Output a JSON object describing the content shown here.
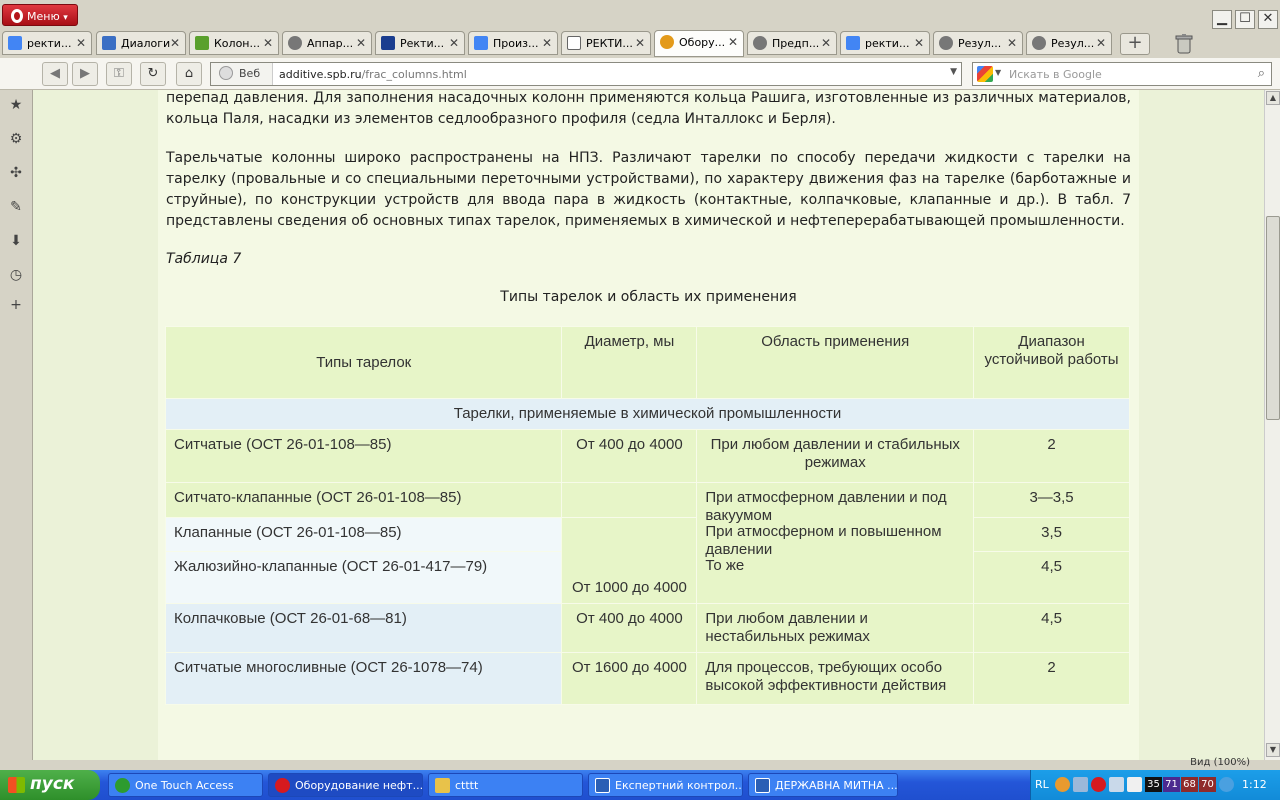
{
  "browser": {
    "menu_label": "Меню",
    "tabs": [
      {
        "label": "ректи...",
        "icon": "google-icon",
        "color": "#4285f4"
      },
      {
        "label": "Диалоги",
        "icon": "speech-bubble-icon",
        "color": "#3b6fc4"
      },
      {
        "label": "Колон...",
        "icon": "spreadsheet-icon",
        "color": "#5aa02c"
      },
      {
        "label": "Аппар...",
        "icon": "globe-icon",
        "color": "#777777"
      },
      {
        "label": "Ректи...",
        "icon": "site-icon",
        "color": "#1a3d8f"
      },
      {
        "label": "Произ...",
        "icon": "google-icon",
        "color": "#4285f4"
      },
      {
        "label": "РЕКТИ...",
        "icon": "document-icon",
        "color": "#666666"
      },
      {
        "label": "Обору...",
        "icon": "gear-site-icon",
        "color": "#e39a1a"
      },
      {
        "label": "Предп...",
        "icon": "globe-icon",
        "color": "#777777"
      },
      {
        "label": "ректи...",
        "icon": "google-icon",
        "color": "#4285f4"
      },
      {
        "label": "Резул...",
        "icon": "globe-icon",
        "color": "#777777"
      },
      {
        "label": "Резул...",
        "icon": "globe-icon",
        "color": "#777777"
      }
    ],
    "active_tab": 7,
    "address": {
      "label": "Веб",
      "url_domain": "additive.spb.ru",
      "url_path": "/frac_columns.html"
    },
    "search_placeholder": "Искать в Google",
    "zoom": "Вид (100%)"
  },
  "page": {
    "para1": "перепад давления. Для заполнения насадочных колонн применяются кольца Рашига, изготовленные из различных материалов, кольца Паля, насадки из элементов седлообразного профиля (седла Инталлокс и Берля).",
    "para2": "Тарельчатые колонны широко распространены на НПЗ. Различают тарелки по способу передачи жидкости с тарелки на тарелку (провальные и со специальными переточными устройствами), по характеру движения фаз на тарелке (барботажные и струйные), по конструкции устройств для ввода пара в жидкость (контактные, колпачковые, клапанные и др.). В табл. 7 представлены сведения об основных типах тарелок, применяемых в химической и нефтеперерабатывающей промышленности.",
    "table_caption": "Таблица 7",
    "table_title": "Типы тарелок и область их применения",
    "table": {
      "headers": [
        "Типы тарелок",
        "Диаметр, мы",
        "Область применения",
        "Диапазон устойчивой работы"
      ],
      "group": "Тарелки, применяемые в химической промышленности",
      "rows": {
        "r1": {
          "type": "Ситчатые (ОСТ 26-01-108—85)",
          "diameter": "От 400 до 4000",
          "area": "При любом давлении и стабильных режимах",
          "range": "2"
        },
        "r2": {
          "type": "Ситчато-клапанные (ОСТ 26-01-108—85)",
          "range": "3—3,5"
        },
        "r3": {
          "type": "Клапанные (ОСТ 26-01-108—85)",
          "range": "3,5"
        },
        "r4": {
          "type": "Жалюзийно-клапанные (ОСТ 26-01-417—79)",
          "diameter": "От 1000 до 4000",
          "range": "4,5"
        },
        "area_2_4": [
          "При атмосферном давлении и под вакуумом",
          "При атмосферном и повышенном давлении",
          "То же"
        ],
        "r5": {
          "type": "Колпачковые (ОСТ 26-01-68—81)",
          "diameter": "От 400 до 4000",
          "area": "При любом давлении и нестабильных режимах",
          "range": "4,5"
        },
        "r6": {
          "type": "Ситчатые многосливные (ОСТ 26-1078—74)",
          "diameter": "От 1600 до 4000",
          "area": "Для процессов, требующих особо высокой эффективности действия",
          "range": "2"
        }
      }
    }
  },
  "taskbar": {
    "start_label": "пуск",
    "tasks": [
      {
        "label": "One Touch Access",
        "color": "#2d9b2f"
      },
      {
        "label": "Оборудование нефт...",
        "color": "#d61a1f"
      },
      {
        "label": "ctttt",
        "color": "#e8c24a"
      },
      {
        "label": "Експертний контрол...",
        "color": "#2b5fb5"
      },
      {
        "label": "ДЕРЖАВНА МИТНА ...",
        "color": "#2b5fb5"
      }
    ],
    "tray": {
      "lang": "RL",
      "nums": [
        "35",
        "71",
        "68",
        "70"
      ],
      "clock": "1:12"
    }
  }
}
